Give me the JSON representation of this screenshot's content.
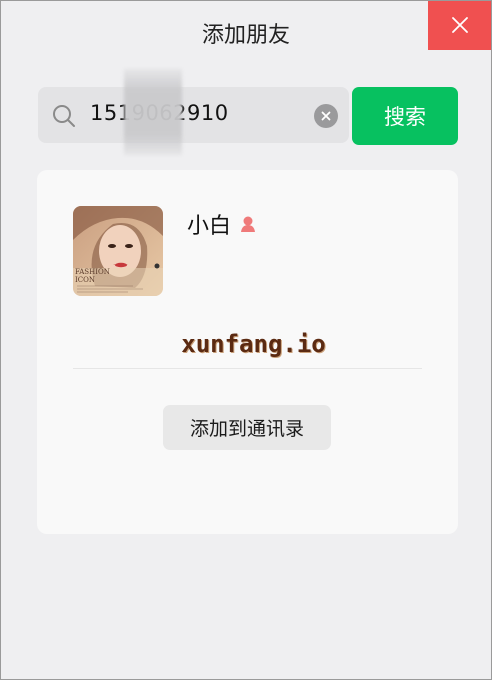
{
  "window": {
    "title": "添加朋友"
  },
  "search": {
    "value": "1519062910",
    "button_label": "搜索"
  },
  "result": {
    "name": "小白",
    "avatar": {
      "caption_line1": "FASHION",
      "caption_line2": "ICON"
    },
    "watermark": "xunfang.io",
    "add_button_label": "添加到通讯录"
  },
  "colors": {
    "accent": "#07c160",
    "close": "#f05050",
    "gender_female": "#ef7a7a"
  },
  "icons": [
    "close-icon",
    "search-icon",
    "clear-icon",
    "gender-female-icon"
  ]
}
